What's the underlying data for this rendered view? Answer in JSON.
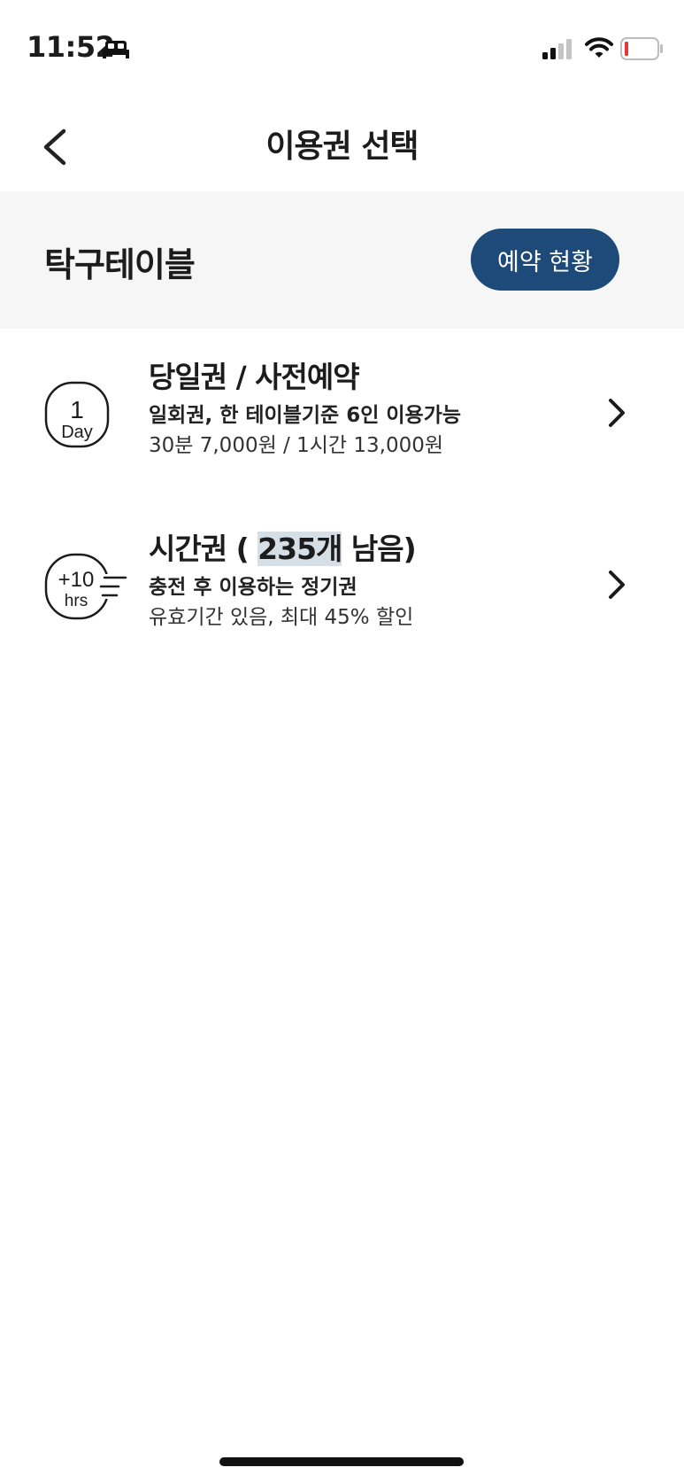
{
  "status_bar": {
    "time": "11:52"
  },
  "nav": {
    "title": "이용권 선택"
  },
  "section": {
    "title": "탁구테이블",
    "reservation_button": "예약 현황"
  },
  "tickets": [
    {
      "title": "당일권 / 사전예약",
      "description": "일회권, 한 테이블기준 6인 이용가능",
      "detail": "30분 7,000원 / 1시간 13,000원",
      "icon": {
        "top": "1",
        "bottom": "Day"
      }
    },
    {
      "title_prefix": "시간권 ( ",
      "title_count": "235개",
      "title_suffix": " 남음)",
      "description": "충전 후 이용하는 정기권",
      "detail": "유효기간 있음, 최대 45% 할인",
      "icon": {
        "top": "+10",
        "bottom": "hrs"
      }
    }
  ]
}
